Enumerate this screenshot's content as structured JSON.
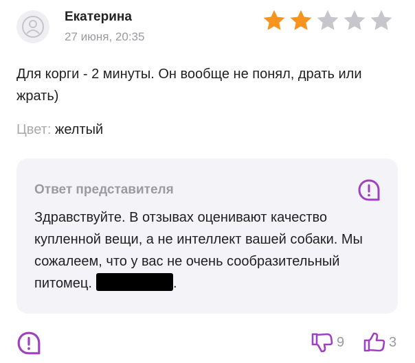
{
  "review": {
    "author": "Екатерина",
    "date": "27 июня, 20:35",
    "rating": 2,
    "rating_max": 5,
    "text": "Для корги - 2 минуты. Он вообще не понял, драть или жрать)",
    "color_label": "Цвет:",
    "color_value": "желтый"
  },
  "reply": {
    "title": "Ответ представителя",
    "text": "Здравствуйте. В отзывах оценивают качество купленной вещи, а не интеллект вашей собаки. Мы сожалеем, что у вас не очень сообразительный питомец.",
    "text_end": "."
  },
  "footer": {
    "dislikes": "9",
    "likes": "3"
  },
  "colors": {
    "star_filled": "#f7941d",
    "star_empty": "#c6c6cc",
    "accent": "#a040c0",
    "card_bg": "#f4f3f8",
    "muted_text": "#9a9aa0"
  },
  "icons": {
    "avatar": "user-icon",
    "reply_action": "report-icon",
    "report": "report-icon",
    "dislike": "thumbs-down-icon",
    "like": "thumbs-up-icon",
    "star": "star-icon"
  }
}
